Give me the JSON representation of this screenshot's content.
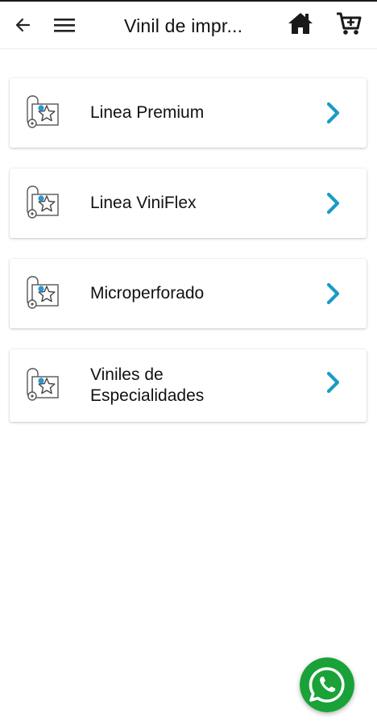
{
  "appbar": {
    "title": "Vinil de impr...",
    "back_icon": "back-arrow-icon",
    "menu_icon": "hamburger-menu-icon",
    "home_icon": "home-icon",
    "cart_icon": "cart-add-icon"
  },
  "categories": [
    {
      "label": "Linea Premium",
      "icon": "vinyl-roll-star-icon"
    },
    {
      "label": "Linea ViniFlex",
      "icon": "vinyl-roll-star-icon"
    },
    {
      "label": "Microperforado",
      "icon": "vinyl-roll-star-icon"
    },
    {
      "label": "Viniles de Especialidades",
      "icon": "vinyl-roll-star-icon"
    }
  ],
  "colors": {
    "accent": "#1b9bc4",
    "whatsapp": "#1aa238",
    "text": "#111111"
  },
  "fab": {
    "icon": "whatsapp-icon"
  }
}
